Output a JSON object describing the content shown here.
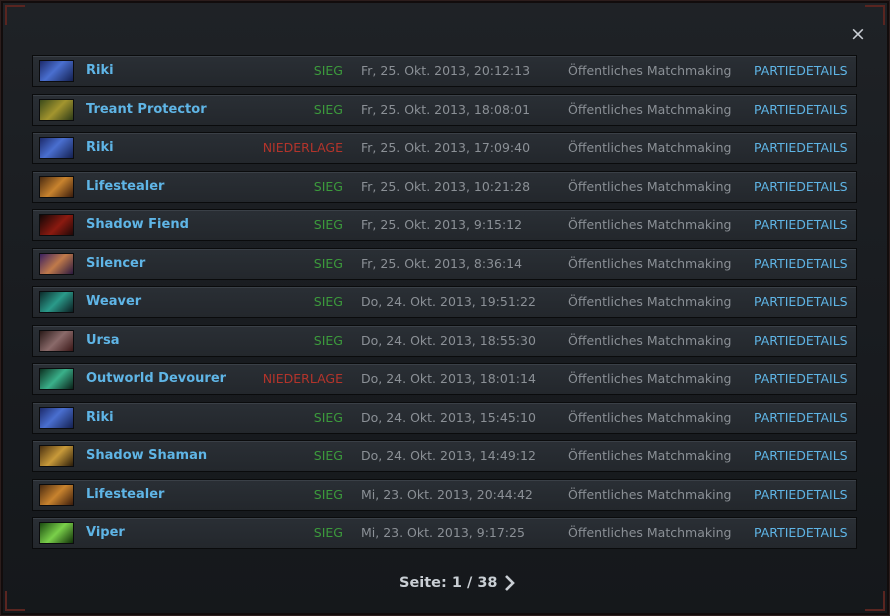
{
  "window": {
    "close_label": "×"
  },
  "matches": [
    {
      "hero": "Riki",
      "portrait": "p-riki",
      "result": "SIEG",
      "outcome": "win",
      "date": "Fr, 25. Okt. 2013, 20:12:13",
      "mode": "Öffentliches Matchmaking",
      "details": "PARTIEDETAILS"
    },
    {
      "hero": "Treant Protector",
      "portrait": "p-treant",
      "result": "SIEG",
      "outcome": "win",
      "date": "Fr, 25. Okt. 2013, 18:08:01",
      "mode": "Öffentliches Matchmaking",
      "details": "PARTIEDETAILS"
    },
    {
      "hero": "Riki",
      "portrait": "p-riki",
      "result": "NIEDERLAGE",
      "outcome": "loss",
      "date": "Fr, 25. Okt. 2013, 17:09:40",
      "mode": "Öffentliches Matchmaking",
      "details": "PARTIEDETAILS"
    },
    {
      "hero": "Lifestealer",
      "portrait": "p-lifestealer",
      "result": "SIEG",
      "outcome": "win",
      "date": "Fr, 25. Okt. 2013, 10:21:28",
      "mode": "Öffentliches Matchmaking",
      "details": "PARTIEDETAILS"
    },
    {
      "hero": "Shadow Fiend",
      "portrait": "p-shadowfiend",
      "result": "SIEG",
      "outcome": "win",
      "date": "Fr, 25. Okt. 2013, 9:15:12",
      "mode": "Öffentliches Matchmaking",
      "details": "PARTIEDETAILS"
    },
    {
      "hero": "Silencer",
      "portrait": "p-silencer",
      "result": "SIEG",
      "outcome": "win",
      "date": "Fr, 25. Okt. 2013, 8:36:14",
      "mode": "Öffentliches Matchmaking",
      "details": "PARTIEDETAILS"
    },
    {
      "hero": "Weaver",
      "portrait": "p-weaver",
      "result": "SIEG",
      "outcome": "win",
      "date": "Do, 24. Okt. 2013, 19:51:22",
      "mode": "Öffentliches Matchmaking",
      "details": "PARTIEDETAILS"
    },
    {
      "hero": "Ursa",
      "portrait": "p-ursa",
      "result": "SIEG",
      "outcome": "win",
      "date": "Do, 24. Okt. 2013, 18:55:30",
      "mode": "Öffentliches Matchmaking",
      "details": "PARTIEDETAILS"
    },
    {
      "hero": "Outworld Devourer",
      "portrait": "p-od",
      "result": "NIEDERLAGE",
      "outcome": "loss",
      "date": "Do, 24. Okt. 2013, 18:01:14",
      "mode": "Öffentliches Matchmaking",
      "details": "PARTIEDETAILS"
    },
    {
      "hero": "Riki",
      "portrait": "p-riki",
      "result": "SIEG",
      "outcome": "win",
      "date": "Do, 24. Okt. 2013, 15:45:10",
      "mode": "Öffentliches Matchmaking",
      "details": "PARTIEDETAILS"
    },
    {
      "hero": "Shadow Shaman",
      "portrait": "p-shaman",
      "result": "SIEG",
      "outcome": "win",
      "date": "Do, 24. Okt. 2013, 14:49:12",
      "mode": "Öffentliches Matchmaking",
      "details": "PARTIEDETAILS"
    },
    {
      "hero": "Lifestealer",
      "portrait": "p-lifestealer",
      "result": "SIEG",
      "outcome": "win",
      "date": "Mi, 23. Okt. 2013, 20:44:42",
      "mode": "Öffentliches Matchmaking",
      "details": "PARTIEDETAILS"
    },
    {
      "hero": "Viper",
      "portrait": "p-viper",
      "result": "SIEG",
      "outcome": "win",
      "date": "Mi, 23. Okt. 2013, 9:17:25",
      "mode": "Öffentliches Matchmaking",
      "details": "PARTIEDETAILS"
    }
  ],
  "pager": {
    "label": "Seite: 1 / 38"
  },
  "colors": {
    "accent": "#5fb5e6",
    "win": "#3c9a3c",
    "loss": "#b3342b"
  }
}
